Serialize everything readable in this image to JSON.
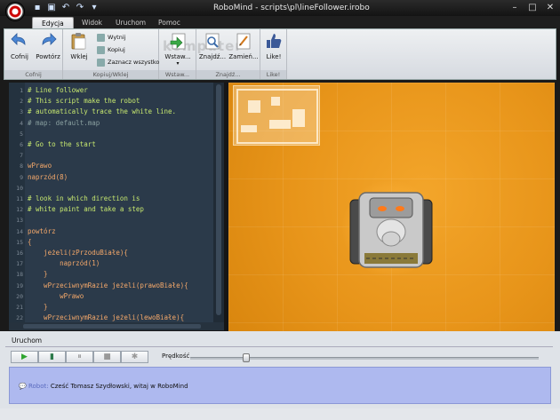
{
  "window": {
    "title": "RoboMind - scripts\\pl\\lineFollower.irobo",
    "controls": {
      "minimize": "–",
      "maximize": "□",
      "close": "✕"
    }
  },
  "quick_access": [
    "save-icon",
    "open-icon",
    "undo-icon",
    "redo-icon",
    "dropdown-icon"
  ],
  "tabs": [
    {
      "label": "Edycja",
      "active": true
    },
    {
      "label": "Widok",
      "active": false
    },
    {
      "label": "Uruchom",
      "active": false
    },
    {
      "label": "Pomoc",
      "active": false
    }
  ],
  "ribbon": {
    "groups": [
      {
        "label": "Cofnij",
        "buttons": [
          "Cofnij",
          "Powtórz"
        ]
      },
      {
        "label": "Kopiuj/Wklej",
        "buttons": [
          "Wklej"
        ],
        "small_buttons": [
          "Wytnij",
          "Kopiuj",
          "Zaznacz wszystko"
        ]
      },
      {
        "label": "Wstaw...",
        "buttons": [
          "Wstaw..."
        ]
      },
      {
        "label": "Znajdź...",
        "buttons": [
          "Znajdź...",
          "Zamień..."
        ]
      },
      {
        "label": "Like!",
        "buttons": [
          "Like!"
        ]
      }
    ],
    "watermark": "komputer"
  },
  "editor": {
    "lines": [
      {
        "n": "1",
        "text": "# Line follower",
        "kind": "comment"
      },
      {
        "n": "2",
        "text": "# This script make the robot",
        "kind": "comment"
      },
      {
        "n": "3",
        "text": "# automatically trace the white line.",
        "kind": "comment"
      },
      {
        "n": "4",
        "text": "# map: default.map",
        "kind": "comment2"
      },
      {
        "n": "5",
        "text": "",
        "kind": "txt"
      },
      {
        "n": "6",
        "text": "# Go to the start",
        "kind": "comment"
      },
      {
        "n": "7",
        "text": "",
        "kind": "txt"
      },
      {
        "n": "8",
        "text": "wPrawo",
        "kind": "kw"
      },
      {
        "n": "9",
        "text": "naprzód(8)",
        "kind": "kw"
      },
      {
        "n": "10",
        "text": "",
        "kind": "txt"
      },
      {
        "n": "11",
        "text": "# look in which direction is",
        "kind": "comment"
      },
      {
        "n": "12",
        "text": "# white paint and take a step",
        "kind": "comment"
      },
      {
        "n": "13",
        "text": "",
        "kind": "txt"
      },
      {
        "n": "14",
        "text": "powtórz",
        "kind": "kw"
      },
      {
        "n": "15",
        "text": "{",
        "kind": "kw"
      },
      {
        "n": "16",
        "text": "    jeżeli(zPrzoduBiałe){",
        "kind": "kw"
      },
      {
        "n": "17",
        "text": "        naprzód(1)",
        "kind": "kw"
      },
      {
        "n": "18",
        "text": "    }",
        "kind": "kw"
      },
      {
        "n": "19",
        "text": "    wPrzeciwnymRazie jeżeli(prawoBiałe){",
        "kind": "kw"
      },
      {
        "n": "20",
        "text": "        wPrawo",
        "kind": "kw"
      },
      {
        "n": "21",
        "text": "    }",
        "kind": "kw"
      },
      {
        "n": "22",
        "text": "    wPrzeciwnymRazie jeżeli(lewoBiałe){",
        "kind": "kw"
      }
    ]
  },
  "bottom": {
    "run_tab_label": "Uruchom",
    "speed_label": "Prędkość",
    "speed_value": 0.16,
    "controls": [
      {
        "icon": "play-icon",
        "glyph": "▶",
        "cls": "play"
      },
      {
        "icon": "step-icon",
        "glyph": "▮",
        "cls": "step"
      },
      {
        "icon": "pause-icon",
        "glyph": "⏸",
        "cls": ""
      },
      {
        "icon": "stop-icon",
        "glyph": "■",
        "cls": ""
      },
      {
        "icon": "reset-icon",
        "glyph": "✱",
        "cls": ""
      }
    ],
    "message_sender": "Robot:",
    "message_text": "Cześć Tomasz Szydłowski, witaj w RoboMind"
  },
  "colors": {
    "editor_bg": "#2b3a4a",
    "map_orange": "#e8951a",
    "message_bg": "#aeb9ef"
  }
}
